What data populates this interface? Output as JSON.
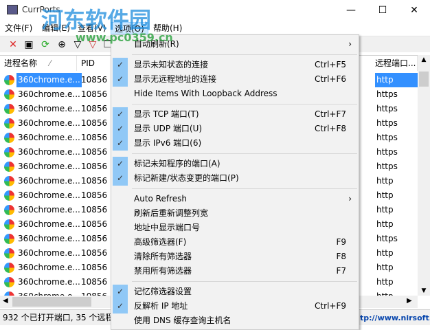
{
  "window": {
    "title": "CurrPorts",
    "minimize": "—",
    "maximize": "☐",
    "close": "✕"
  },
  "menubar": [
    "文件(F)",
    "编辑(E)",
    "查看(V)",
    "选项(O)",
    "帮助(H)"
  ],
  "toolbar_icons": [
    "close-connection-icon",
    "save-icon",
    "refresh-icon",
    "properties-icon",
    "filter-icon",
    "clear-filter-icon",
    "copy-icon"
  ],
  "columns": {
    "process_name": "进程名称",
    "pid": "PID",
    "remote_port": "远程端口..."
  },
  "rows": [
    {
      "name": "360chrome.e...",
      "pid": "10856",
      "remote": "http"
    },
    {
      "name": "360chrome.e...",
      "pid": "10856",
      "remote": "https"
    },
    {
      "name": "360chrome.e...",
      "pid": "10856",
      "remote": "https"
    },
    {
      "name": "360chrome.e...",
      "pid": "10856",
      "remote": "https"
    },
    {
      "name": "360chrome.e...",
      "pid": "10856",
      "remote": "https"
    },
    {
      "name": "360chrome.e...",
      "pid": "10856",
      "remote": "https"
    },
    {
      "name": "360chrome.e...",
      "pid": "10856",
      "remote": "https"
    },
    {
      "name": "360chrome.e...",
      "pid": "10856",
      "remote": "http"
    },
    {
      "name": "360chrome.e...",
      "pid": "10856",
      "remote": "http"
    },
    {
      "name": "360chrome.e...",
      "pid": "10856",
      "remote": "http"
    },
    {
      "name": "360chrome.e...",
      "pid": "10856",
      "remote": "http"
    },
    {
      "name": "360chrome.e...",
      "pid": "10856",
      "remote": "https"
    },
    {
      "name": "360chrome.e...",
      "pid": "10856",
      "remote": "http"
    },
    {
      "name": "360chrome.e...",
      "pid": "10856",
      "remote": "http"
    },
    {
      "name": "360chrome.e...",
      "pid": "10856",
      "remote": "http"
    },
    {
      "name": "360chrome.e...",
      "pid": "10856",
      "remote": "http"
    }
  ],
  "status": {
    "left": "932 个已打开端口, 35 个远程",
    "right": "tp://www.nirsoft.ne"
  },
  "options_menu": [
    {
      "label": "自动刷新(R)",
      "submenu": true
    },
    {
      "sep": true
    },
    {
      "label": "显示未知状态的连接",
      "shortcut": "Ctrl+F5",
      "checked": true
    },
    {
      "label": "显示无远程地址的连接",
      "shortcut": "Ctrl+F6",
      "checked": true
    },
    {
      "label": "Hide Items With Loopback Address"
    },
    {
      "sep": true
    },
    {
      "label": "显示 TCP 端口(T)",
      "shortcut": "Ctrl+F7",
      "checked": true
    },
    {
      "label": "显示 UDP 端口(U)",
      "shortcut": "Ctrl+F8",
      "checked": true
    },
    {
      "label": "显示 IPv6 端口(6)",
      "checked": true
    },
    {
      "sep": true
    },
    {
      "label": "标记未知程序的端口(A)",
      "checked": true
    },
    {
      "label": "标记新建/状态变更的端口(P)",
      "checked": true
    },
    {
      "sep": true
    },
    {
      "label": "Auto Refresh",
      "submenu": true
    },
    {
      "label": "刷新后重新调整列宽"
    },
    {
      "label": "地址中显示端口号"
    },
    {
      "label": "高级筛选器(F)",
      "shortcut": "F9"
    },
    {
      "label": "清除所有筛选器",
      "shortcut": "F8"
    },
    {
      "label": "禁用所有筛选器",
      "shortcut": "F7"
    },
    {
      "sep": true
    },
    {
      "label": "记忆筛选器设置",
      "checked": true
    },
    {
      "label": "反解析 IP 地址",
      "shortcut": "Ctrl+F9",
      "checked": true
    },
    {
      "label": "使用 DNS 缓存查询主机名"
    }
  ],
  "watermark": {
    "main": "河东软件园",
    "url": "www.pc0359.cn"
  }
}
